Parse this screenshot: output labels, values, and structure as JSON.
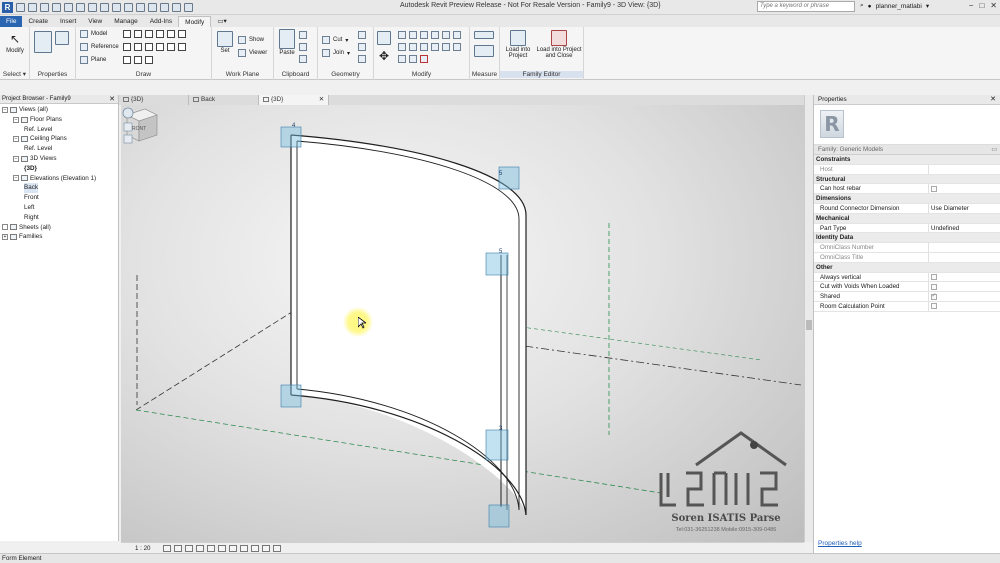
{
  "window": {
    "title": "Autodesk Revit Preview Release - Not For Resale Version - Family9 - 3D View: {3D}",
    "search_placeholder": "Type a keyword or phrase",
    "user": "planner_matlabi"
  },
  "ribbon": {
    "tabs": [
      "File",
      "Create",
      "Insert",
      "View",
      "Manage",
      "Add-Ins",
      "Modify"
    ],
    "active_tab": "Modify",
    "buttons": {
      "modify": "Modify",
      "model": "Model",
      "reference": "Reference",
      "plane": "Plane",
      "set": "Set",
      "show": "Show",
      "viewer": "Viewer",
      "paste": "Paste",
      "cut": "Cut",
      "join": "Join",
      "load_into_project": "Load into Project",
      "load_into_project_close": "Load into Project and Close"
    },
    "panels": {
      "select": "Select",
      "properties": "Properties",
      "draw": "Draw",
      "work_plane": "Work Plane",
      "clipboard": "Clipboard",
      "geometry": "Geometry",
      "modify": "Modify",
      "measure": "Measure",
      "family_editor": "Family Editor"
    }
  },
  "project_browser": {
    "title": "Project Browser - Family9",
    "tree": [
      {
        "label": "Views (all)",
        "level": 0,
        "toggle": "−"
      },
      {
        "label": "Floor Plans",
        "level": 1,
        "toggle": "−"
      },
      {
        "label": "Ref. Level",
        "level": 2
      },
      {
        "label": "Ceiling Plans",
        "level": 1,
        "toggle": "−"
      },
      {
        "label": "Ref. Level",
        "level": 2
      },
      {
        "label": "3D Views",
        "level": 1,
        "toggle": "−"
      },
      {
        "label": "{3D}",
        "level": 2,
        "bold": true
      },
      {
        "label": "Elevations (Elevation 1)",
        "level": 1,
        "toggle": "−"
      },
      {
        "label": "Back",
        "level": 2,
        "selected": true
      },
      {
        "label": "Front",
        "level": 2
      },
      {
        "label": "Left",
        "level": 2
      },
      {
        "label": "Right",
        "level": 2
      },
      {
        "label": "Sheets (all)",
        "level": 0,
        "toggle": " "
      },
      {
        "label": "Families",
        "level": 0,
        "toggle": "+"
      }
    ]
  },
  "view_tabs": [
    {
      "label": "{3D}",
      "active": false
    },
    {
      "label": "Back",
      "active": false
    },
    {
      "label": "{3D}",
      "active": true
    }
  ],
  "canvas": {
    "viewcube_face": "FRONT",
    "grip_labels": [
      "4",
      "5",
      "5",
      "3"
    ],
    "watermark_line1": "Soren ISATIS Parse",
    "watermark_line2": "Tel:031-36251238 Mobile:0915-309-0486"
  },
  "properties": {
    "title": "Properties",
    "family": "Family: Generic Models",
    "rows": [
      {
        "group": "Constraints"
      },
      {
        "name": "Host",
        "value": "",
        "dim": true
      },
      {
        "group": "Structural"
      },
      {
        "name": "Can host rebar",
        "check": false
      },
      {
        "group": "Dimensions"
      },
      {
        "name": "Round Connector Dimension",
        "value": "Use Diameter"
      },
      {
        "group": "Mechanical"
      },
      {
        "name": "Part Type",
        "value": "Undefined"
      },
      {
        "group": "Identity Data"
      },
      {
        "name": "OmniClass Number",
        "value": "",
        "dim": true
      },
      {
        "name": "OmniClass Title",
        "value": "",
        "dim": true
      },
      {
        "group": "Other"
      },
      {
        "name": "Always vertical",
        "check": false
      },
      {
        "name": "Cut with Voids When Loaded",
        "check": false
      },
      {
        "name": "Shared",
        "check": true
      },
      {
        "name": "Room Calculation Point",
        "check": false
      }
    ],
    "help": "Properties help"
  },
  "view_control": {
    "scale": "1 : 20"
  },
  "status": {
    "text": "Form Element"
  }
}
